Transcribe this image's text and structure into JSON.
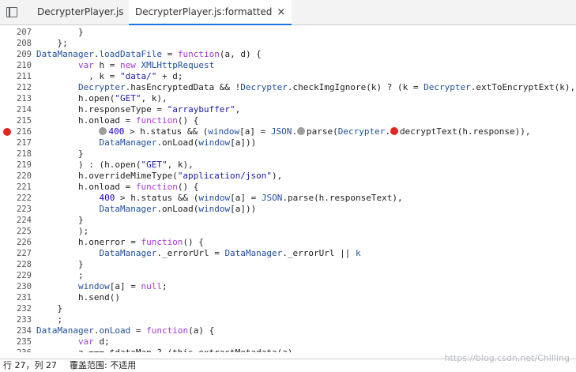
{
  "tabs": [
    {
      "label": "DecrypterPlayer.js",
      "active": false
    },
    {
      "label": "DecrypterPlayer.js:formatted",
      "active": true,
      "close": "×"
    }
  ],
  "lines": [
    {
      "n": "207",
      "bp": false,
      "tokens": [
        [
          "p",
          "        }"
        ]
      ]
    },
    {
      "n": "208",
      "bp": false,
      "tokens": [
        [
          "p",
          "    };"
        ]
      ]
    },
    {
      "n": "209",
      "bp": false,
      "tokens": [
        [
          "ref",
          "DataManager"
        ],
        [
          "p",
          "."
        ],
        [
          "ref",
          "loadDataFile"
        ],
        [
          "p",
          " = "
        ],
        [
          "kw",
          "function"
        ],
        [
          "p",
          "(a, d) {"
        ]
      ]
    },
    {
      "n": "210",
      "bp": false,
      "tokens": [
        [
          "p",
          "        "
        ],
        [
          "kw",
          "var"
        ],
        [
          "p",
          " h = "
        ],
        [
          "kw",
          "new"
        ],
        [
          "p",
          " "
        ],
        [
          "ref",
          "XMLHttpRequest"
        ]
      ]
    },
    {
      "n": "211",
      "bp": false,
      "tokens": [
        [
          "p",
          "          , k = "
        ],
        [
          "str",
          "\"data/\""
        ],
        [
          "p",
          " + d;"
        ]
      ]
    },
    {
      "n": "212",
      "bp": false,
      "tokens": [
        [
          "p",
          "        "
        ],
        [
          "ref",
          "Decrypter"
        ],
        [
          "p",
          ".hasEncryptedData && !"
        ],
        [
          "ref",
          "Decrypter"
        ],
        [
          "p",
          ".checkImgIgnore(k) ? (k = "
        ],
        [
          "ref",
          "Decrypter"
        ],
        [
          "p",
          ".extToEncryptExt(k),"
        ]
      ]
    },
    {
      "n": "213",
      "bp": false,
      "tokens": [
        [
          "p",
          "        h.open("
        ],
        [
          "str",
          "\"GET\""
        ],
        [
          "p",
          ", k),"
        ]
      ]
    },
    {
      "n": "214",
      "bp": false,
      "tokens": [
        [
          "p",
          "        h.responseType = "
        ],
        [
          "str",
          "\"arraybuffer\""
        ],
        [
          "p",
          ","
        ]
      ]
    },
    {
      "n": "215",
      "bp": false,
      "tokens": [
        [
          "p",
          "        h.onload = "
        ],
        [
          "kw",
          "function"
        ],
        [
          "p",
          "() {"
        ]
      ]
    },
    {
      "n": "216",
      "bp": true,
      "tokens": [
        [
          "p",
          "            "
        ],
        [
          "mk",
          "grey"
        ],
        [
          "num",
          "400"
        ],
        [
          "p",
          " > h.status && ("
        ],
        [
          "ref",
          "window"
        ],
        [
          "p",
          "[a] = "
        ],
        [
          "ref",
          "JSON"
        ],
        [
          "p",
          "."
        ],
        [
          "mk",
          "grey"
        ],
        [
          "p",
          "parse("
        ],
        [
          "ref",
          "Decrypter"
        ],
        [
          "p",
          "."
        ],
        [
          "mk",
          "red"
        ],
        [
          "p",
          "decryptText(h.response)),"
        ]
      ]
    },
    {
      "n": "217",
      "bp": false,
      "tokens": [
        [
          "p",
          "            "
        ],
        [
          "ref",
          "DataManager"
        ],
        [
          "p",
          ".onLoad("
        ],
        [
          "ref",
          "window"
        ],
        [
          "p",
          "[a]))"
        ]
      ]
    },
    {
      "n": "218",
      "bp": false,
      "tokens": [
        [
          "p",
          "        }"
        ]
      ]
    },
    {
      "n": "219",
      "bp": false,
      "tokens": [
        [
          "p",
          "        ) : (h.open("
        ],
        [
          "str",
          "\"GET\""
        ],
        [
          "p",
          ", k),"
        ]
      ]
    },
    {
      "n": "220",
      "bp": false,
      "tokens": [
        [
          "p",
          "        h.overrideMimeType("
        ],
        [
          "str",
          "\"application/json\""
        ],
        [
          "p",
          "),"
        ]
      ]
    },
    {
      "n": "221",
      "bp": false,
      "tokens": [
        [
          "p",
          "        h.onload = "
        ],
        [
          "kw",
          "function"
        ],
        [
          "p",
          "() {"
        ]
      ]
    },
    {
      "n": "222",
      "bp": false,
      "tokens": [
        [
          "p",
          "            "
        ],
        [
          "num",
          "400"
        ],
        [
          "p",
          " > h.status && ("
        ],
        [
          "ref",
          "window"
        ],
        [
          "p",
          "[a] = "
        ],
        [
          "ref",
          "JSON"
        ],
        [
          "p",
          ".parse(h.responseText),"
        ]
      ]
    },
    {
      "n": "223",
      "bp": false,
      "tokens": [
        [
          "p",
          "            "
        ],
        [
          "ref",
          "DataManager"
        ],
        [
          "p",
          ".onLoad("
        ],
        [
          "ref",
          "window"
        ],
        [
          "p",
          "[a]))"
        ]
      ]
    },
    {
      "n": "224",
      "bp": false,
      "tokens": [
        [
          "p",
          "        }"
        ]
      ]
    },
    {
      "n": "225",
      "bp": false,
      "tokens": [
        [
          "p",
          "        );"
        ]
      ]
    },
    {
      "n": "226",
      "bp": false,
      "tokens": [
        [
          "p",
          "        h.onerror = "
        ],
        [
          "kw",
          "function"
        ],
        [
          "p",
          "() {"
        ]
      ]
    },
    {
      "n": "227",
      "bp": false,
      "tokens": [
        [
          "p",
          "            "
        ],
        [
          "ref",
          "DataManager"
        ],
        [
          "p",
          "._errorUrl = "
        ],
        [
          "ref",
          "DataManager"
        ],
        [
          "p",
          "._errorUrl || "
        ],
        [
          "ref",
          "k"
        ]
      ]
    },
    {
      "n": "228",
      "bp": false,
      "tokens": [
        [
          "p",
          "        }"
        ]
      ]
    },
    {
      "n": "229",
      "bp": false,
      "tokens": [
        [
          "p",
          "        ;"
        ]
      ]
    },
    {
      "n": "230",
      "bp": false,
      "tokens": [
        [
          "p",
          "        "
        ],
        [
          "ref",
          "window"
        ],
        [
          "p",
          "[a] = "
        ],
        [
          "kw",
          "null"
        ],
        [
          "p",
          ";"
        ]
      ]
    },
    {
      "n": "231",
      "bp": false,
      "tokens": [
        [
          "p",
          "        h.send()"
        ]
      ]
    },
    {
      "n": "232",
      "bp": false,
      "tokens": [
        [
          "p",
          "    }"
        ]
      ]
    },
    {
      "n": "233",
      "bp": false,
      "tokens": [
        [
          "p",
          "    ;"
        ]
      ]
    },
    {
      "n": "234",
      "bp": false,
      "tokens": [
        [
          "ref",
          "DataManager"
        ],
        [
          "p",
          "."
        ],
        [
          "ref",
          "onLoad"
        ],
        [
          "p",
          " = "
        ],
        [
          "kw",
          "function"
        ],
        [
          "p",
          "(a) {"
        ]
      ]
    },
    {
      "n": "235",
      "bp": false,
      "tokens": [
        [
          "p",
          "        "
        ],
        [
          "kw",
          "var"
        ],
        [
          "p",
          " d;"
        ]
      ]
    },
    {
      "n": "236",
      "bp": false,
      "tokens": [
        [
          "p",
          "        a === $dataMap ? (this.extractMetadata(a)"
        ]
      ]
    }
  ],
  "status": {
    "position": "行 27，列 27",
    "coverage": "覆盖范围: 不适用"
  },
  "watermark": "https://blog.csdn.net/Chilling"
}
